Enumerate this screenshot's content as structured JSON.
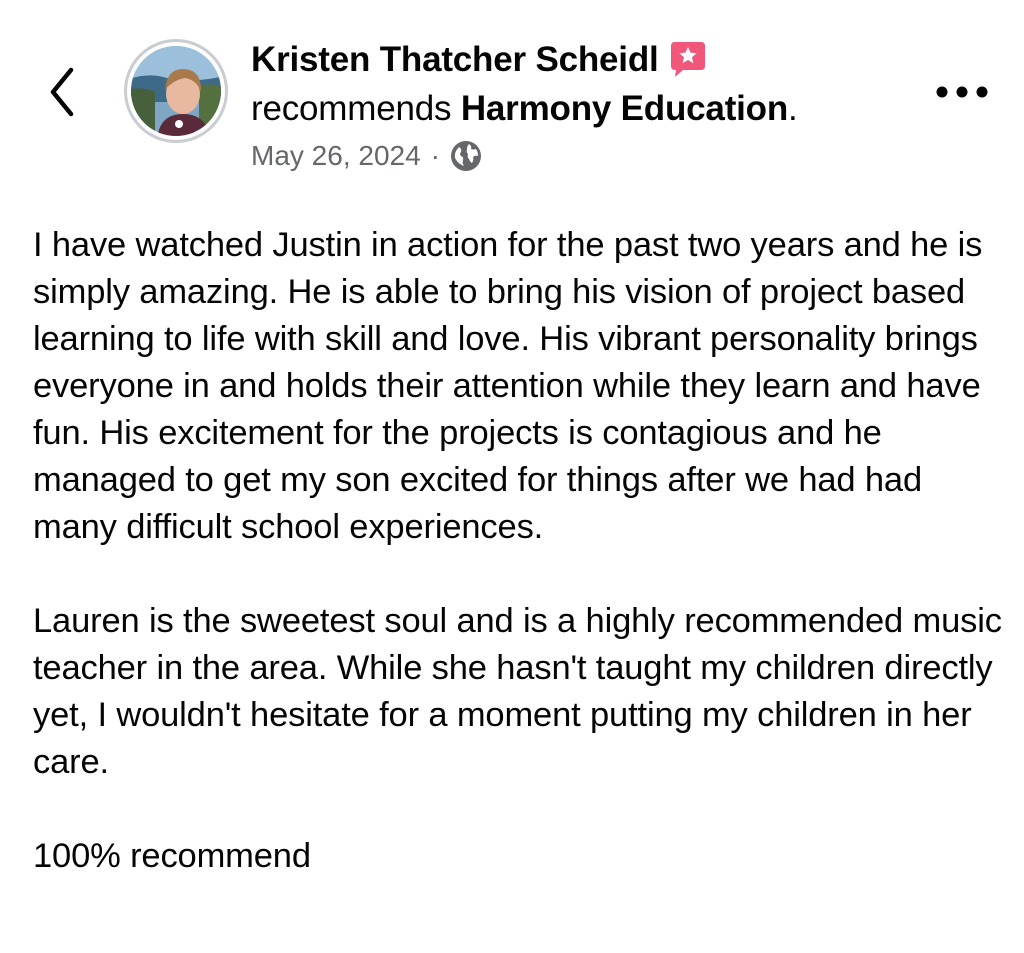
{
  "post": {
    "author_name": "Kristen Thatcher Scheidl",
    "recommends_word": "recommends",
    "page_name": "Harmony Education",
    "date": "May 26, 2024",
    "separator": "·",
    "privacy_icon": "globe-icon",
    "paragraphs": [
      "I have watched Justin in action for the past two years and he is simply amazing. He is able to bring his vision of project based learning to life with skill and love. His vibrant personality brings everyone in and holds their attention while they learn and have fun. His excitement for the projects is contagious and he managed to get my son excited for things after we had had many difficult school experiences.",
      "Lauren is the sweetest soul and is a highly recommended music teacher in the area. While she hasn't taught my children directly yet, I wouldn't hesitate for a moment putting my children in her care.",
      "100% recommend"
    ]
  },
  "icons": {
    "back": "chevron-left-icon",
    "more": "more-horizontal-icon",
    "badge": "star-badge-icon"
  },
  "colors": {
    "text": "#050505",
    "secondary_text": "#65676b",
    "badge": "#f0577a",
    "avatar_ring": "#c9ccd1"
  }
}
